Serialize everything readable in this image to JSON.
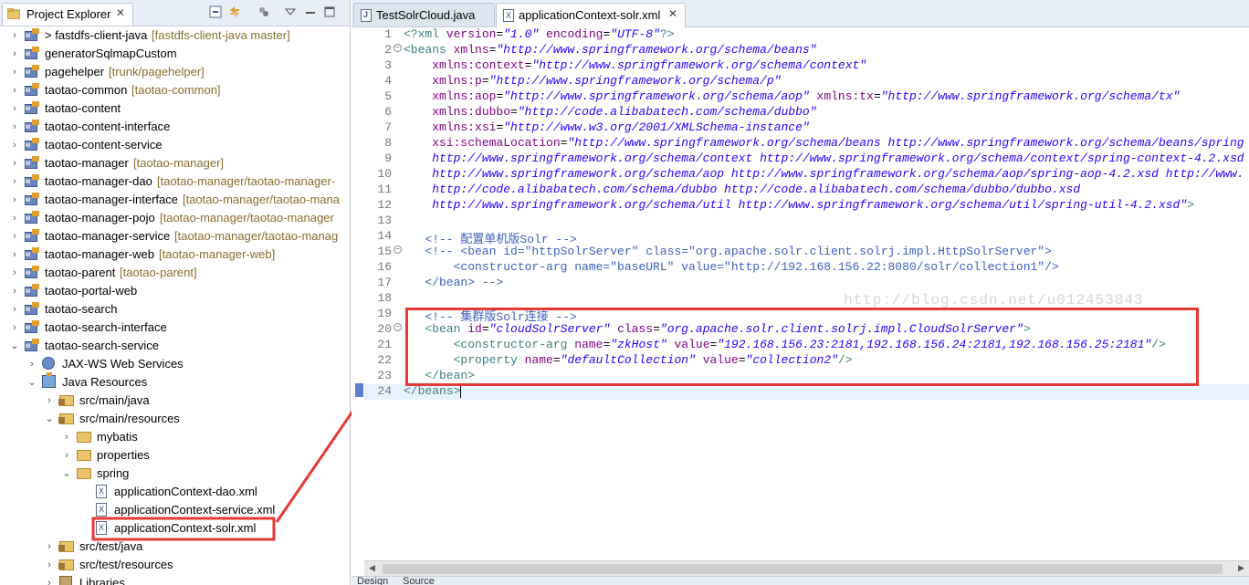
{
  "explorer": {
    "tab_label": "Project Explorer",
    "close_glyph": "✕",
    "toolbar": [
      "collapse-all-icon",
      "link-with-editor-icon",
      "focus-icon",
      "view-menu-icon",
      "minimize-icon",
      "maximize-icon"
    ],
    "tree": [
      {
        "label": "> fastdfs-client-java",
        "decor": "[fastdfs-client-java master]",
        "icon": "project-icon",
        "arrow": "›",
        "depth": 0
      },
      {
        "label": "generatorSqlmapCustom",
        "decor": "",
        "icon": "project-icon",
        "arrow": "›",
        "depth": 0
      },
      {
        "label": "pagehelper",
        "decor": "[trunk/pagehelper]",
        "icon": "project-icon",
        "arrow": "›",
        "depth": 0
      },
      {
        "label": "taotao-common",
        "decor": "[taotao-common]",
        "icon": "project-icon",
        "arrow": "›",
        "depth": 0
      },
      {
        "label": "taotao-content",
        "decor": "",
        "icon": "project-icon",
        "arrow": "›",
        "depth": 0
      },
      {
        "label": "taotao-content-interface",
        "decor": "",
        "icon": "project-icon",
        "arrow": "›",
        "depth": 0
      },
      {
        "label": "taotao-content-service",
        "decor": "",
        "icon": "project-icon",
        "arrow": "›",
        "depth": 0
      },
      {
        "label": "taotao-manager",
        "decor": "[taotao-manager]",
        "icon": "project-icon",
        "arrow": "›",
        "depth": 0
      },
      {
        "label": "taotao-manager-dao",
        "decor": "[taotao-manager/taotao-manager-",
        "icon": "project-icon",
        "arrow": "›",
        "depth": 0
      },
      {
        "label": "taotao-manager-interface",
        "decor": "[taotao-manager/taotao-mana",
        "icon": "project-icon",
        "arrow": "›",
        "depth": 0
      },
      {
        "label": "taotao-manager-pojo",
        "decor": "[taotao-manager/taotao-manager",
        "icon": "project-icon",
        "arrow": "›",
        "depth": 0
      },
      {
        "label": "taotao-manager-service",
        "decor": "[taotao-manager/taotao-manag",
        "icon": "project-icon",
        "arrow": "›",
        "depth": 0
      },
      {
        "label": "taotao-manager-web",
        "decor": "[taotao-manager-web]",
        "icon": "project-icon",
        "arrow": "›",
        "depth": 0
      },
      {
        "label": "taotao-parent",
        "decor": "[taotao-parent]",
        "icon": "project-icon",
        "arrow": "›",
        "depth": 0
      },
      {
        "label": "taotao-portal-web",
        "decor": "",
        "icon": "project-icon",
        "arrow": "›",
        "depth": 0
      },
      {
        "label": "taotao-search",
        "decor": "",
        "icon": "project-icon",
        "arrow": "›",
        "depth": 0
      },
      {
        "label": "taotao-search-interface",
        "decor": "",
        "icon": "project-icon",
        "arrow": "›",
        "depth": 0
      },
      {
        "label": "taotao-search-service",
        "decor": "",
        "icon": "project-icon",
        "arrow": "⌄",
        "depth": 0
      },
      {
        "label": "JAX-WS Web Services",
        "decor": "",
        "icon": "web-services-icon",
        "arrow": "›",
        "depth": 1
      },
      {
        "label": "Java Resources",
        "decor": "",
        "icon": "java-resources-icon",
        "arrow": "⌄",
        "depth": 1
      },
      {
        "label": "src/main/java",
        "decor": "",
        "icon": "source-folder-icon",
        "arrow": "›",
        "depth": 2
      },
      {
        "label": "src/main/resources",
        "decor": "",
        "icon": "source-folder-icon",
        "arrow": "⌄",
        "depth": 2
      },
      {
        "label": "mybatis",
        "decor": "",
        "icon": "folder-icon",
        "arrow": "›",
        "depth": 3
      },
      {
        "label": "properties",
        "decor": "",
        "icon": "folder-icon",
        "arrow": "›",
        "depth": 3
      },
      {
        "label": "spring",
        "decor": "",
        "icon": "folder-icon",
        "arrow": "⌄",
        "depth": 3
      },
      {
        "label": "applicationContext-dao.xml",
        "decor": "",
        "icon": "xml-file-icon",
        "arrow": "",
        "depth": 4
      },
      {
        "label": "applicationContext-service.xml",
        "decor": "",
        "icon": "xml-file-icon",
        "arrow": "",
        "depth": 4
      },
      {
        "label": "applicationContext-solr.xml",
        "decor": "",
        "icon": "xml-file-icon",
        "arrow": "",
        "depth": 4,
        "highlighted": true
      },
      {
        "label": "src/test/java",
        "decor": "",
        "icon": "source-folder-icon",
        "arrow": "›",
        "depth": 2
      },
      {
        "label": "src/test/resources",
        "decor": "",
        "icon": "source-folder-icon",
        "arrow": "›",
        "depth": 2
      },
      {
        "label": "Libraries",
        "decor": "",
        "icon": "library-icon",
        "arrow": "›",
        "depth": 2
      }
    ]
  },
  "editor": {
    "tabs": [
      {
        "label": "TestSolrCloud.java",
        "icon": "java-file-icon",
        "active": false
      },
      {
        "label": "applicationContext-solr.xml",
        "icon": "xml-file-icon",
        "active": true,
        "close": "✕"
      }
    ],
    "lines": [
      {
        "n": "1",
        "fold": "",
        "cur": false,
        "segs": [
          [
            "t-pi",
            "<?xml "
          ],
          [
            "t-attr",
            "version"
          ],
          [
            "",
            "="
          ],
          [
            "t-str",
            "\"1.0\""
          ],
          [
            "",
            ""
          ],
          [
            "t-attr",
            " encoding"
          ],
          [
            "",
            "="
          ],
          [
            "t-str",
            "\"UTF-8\""
          ],
          [
            "t-pi",
            "?>"
          ]
        ]
      },
      {
        "n": "2",
        "fold": "−",
        "cur": false,
        "segs": [
          [
            "t-tag",
            "<beans "
          ],
          [
            "t-attr",
            "xmlns"
          ],
          [
            "",
            "="
          ],
          [
            "t-str",
            "\"http://www.springframework.org/schema/beans\""
          ]
        ]
      },
      {
        "n": "3",
        "fold": "",
        "cur": false,
        "segs": [
          [
            "",
            "    "
          ],
          [
            "t-attr",
            "xmlns:context"
          ],
          [
            "",
            "="
          ],
          [
            "t-str",
            "\"http://www.springframework.org/schema/context\""
          ]
        ]
      },
      {
        "n": "4",
        "fold": "",
        "cur": false,
        "segs": [
          [
            "",
            "    "
          ],
          [
            "t-attr",
            "xmlns:p"
          ],
          [
            "",
            "="
          ],
          [
            "t-str",
            "\"http://www.springframework.org/schema/p\""
          ]
        ]
      },
      {
        "n": "5",
        "fold": "",
        "cur": false,
        "segs": [
          [
            "",
            "    "
          ],
          [
            "t-attr",
            "xmlns:aop"
          ],
          [
            "",
            "="
          ],
          [
            "t-str",
            "\"http://www.springframework.org/schema/aop\""
          ],
          [
            "t-attr",
            " xmlns:tx"
          ],
          [
            "",
            "="
          ],
          [
            "t-str",
            "\"http://www.springframework.org/schema/tx\""
          ]
        ]
      },
      {
        "n": "6",
        "fold": "",
        "cur": false,
        "segs": [
          [
            "",
            "    "
          ],
          [
            "t-attr",
            "xmlns:dubbo"
          ],
          [
            "",
            "="
          ],
          [
            "t-str",
            "\"http://code.alibabatech.com/schema/dubbo\""
          ]
        ]
      },
      {
        "n": "7",
        "fold": "",
        "cur": false,
        "segs": [
          [
            "",
            "    "
          ],
          [
            "t-attr",
            "xmlns:xsi"
          ],
          [
            "",
            "="
          ],
          [
            "t-str",
            "\"http://www.w3.org/2001/XMLSchema-instance\""
          ]
        ]
      },
      {
        "n": "8",
        "fold": "",
        "cur": false,
        "segs": [
          [
            "",
            "    "
          ],
          [
            "t-attr",
            "xsi:schemaLocation"
          ],
          [
            "",
            "="
          ],
          [
            "t-str",
            "\"http://www.springframework.org/schema/beans http://www.springframework.org/schema/beans/spring"
          ]
        ]
      },
      {
        "n": "9",
        "fold": "",
        "cur": false,
        "segs": [
          [
            "",
            "    "
          ],
          [
            "t-str",
            "http://www.springframework.org/schema/context http://www.springframework.org/schema/context/spring-context-4.2.xsd"
          ]
        ]
      },
      {
        "n": "10",
        "fold": "",
        "cur": false,
        "segs": [
          [
            "",
            "    "
          ],
          [
            "t-str",
            "http://www.springframework.org/schema/aop http://www.springframework.org/schema/aop/spring-aop-4.2.xsd http://www."
          ]
        ]
      },
      {
        "n": "11",
        "fold": "",
        "cur": false,
        "segs": [
          [
            "",
            "    "
          ],
          [
            "t-str",
            "http://code.alibabatech.com/schema/dubbo http://code.alibabatech.com/schema/dubbo/dubbo.xsd"
          ]
        ]
      },
      {
        "n": "12",
        "fold": "",
        "cur": false,
        "segs": [
          [
            "",
            "    "
          ],
          [
            "t-str",
            "http://www.springframework.org/schema/util http://www.springframework.org/schema/util/spring-util-4.2.xsd\""
          ],
          [
            "t-tag",
            ">"
          ]
        ]
      },
      {
        "n": "13",
        "fold": "",
        "cur": false,
        "segs": [
          [
            "",
            ""
          ]
        ]
      },
      {
        "n": "14",
        "fold": "",
        "cur": false,
        "segs": [
          [
            "",
            "   "
          ],
          [
            "t-com",
            "<!-- 配置单机版Solr -->"
          ]
        ]
      },
      {
        "n": "15",
        "fold": "−",
        "cur": false,
        "segs": [
          [
            "",
            "   "
          ],
          [
            "t-com",
            "<!-- <bean id=\"httpSolrServer\" class=\"org.apache.solr.client.solrj.impl.HttpSolrServer\">"
          ]
        ]
      },
      {
        "n": "16",
        "fold": "",
        "cur": false,
        "segs": [
          [
            "",
            "       "
          ],
          [
            "t-com",
            "<constructor-arg name=\"baseURL\" value=\"http://192.168.156.22:8080/solr/collection1\"/>"
          ]
        ]
      },
      {
        "n": "17",
        "fold": "",
        "cur": false,
        "segs": [
          [
            "",
            "   "
          ],
          [
            "t-com",
            "</bean> -->"
          ]
        ]
      },
      {
        "n": "18",
        "fold": "",
        "cur": false,
        "segs": [
          [
            "",
            ""
          ]
        ]
      },
      {
        "n": "19",
        "fold": "",
        "cur": false,
        "segs": [
          [
            "",
            "   "
          ],
          [
            "t-com",
            "<!-- 集群版Solr连接 -->"
          ]
        ]
      },
      {
        "n": "20",
        "fold": "−",
        "cur": false,
        "segs": [
          [
            "",
            "   "
          ],
          [
            "t-tag",
            "<bean "
          ],
          [
            "t-attr",
            "id"
          ],
          [
            "",
            "="
          ],
          [
            "t-str",
            "\"cloudSolrServer\""
          ],
          [
            "t-attr",
            " class"
          ],
          [
            "",
            "="
          ],
          [
            "t-str",
            "\"org.apache.solr.client.solrj.impl.CloudSolrServer\""
          ],
          [
            "t-tag",
            ">"
          ]
        ]
      },
      {
        "n": "21",
        "fold": "",
        "cur": false,
        "segs": [
          [
            "",
            "       "
          ],
          [
            "t-tag",
            "<constructor-arg "
          ],
          [
            "t-attr",
            "name"
          ],
          [
            "",
            "="
          ],
          [
            "t-str",
            "\"zkHost\""
          ],
          [
            "t-attr",
            " value"
          ],
          [
            "",
            "="
          ],
          [
            "t-str",
            "\"192.168.156.23:2181,192.168.156.24:2181,192.168.156.25:2181\""
          ],
          [
            "t-tag",
            "/>"
          ]
        ]
      },
      {
        "n": "22",
        "fold": "",
        "cur": false,
        "segs": [
          [
            "",
            "       "
          ],
          [
            "t-tag",
            "<property "
          ],
          [
            "t-attr",
            "name"
          ],
          [
            "",
            "="
          ],
          [
            "t-str",
            "\"defaultCollection\""
          ],
          [
            "t-attr",
            " value"
          ],
          [
            "",
            "="
          ],
          [
            "t-str",
            "\"collection2\""
          ],
          [
            "t-tag",
            "/>"
          ]
        ]
      },
      {
        "n": "23",
        "fold": "",
        "cur": false,
        "segs": [
          [
            "",
            "   "
          ],
          [
            "t-tag",
            "</bean>"
          ]
        ]
      },
      {
        "n": "24",
        "fold": "",
        "cur": true,
        "segs": [
          [
            "t-tag",
            "</beans>"
          ]
        ]
      }
    ],
    "watermark": "http://blog.csdn.net/u012453843",
    "bottom_tabs": [
      "Design",
      "Source"
    ]
  }
}
